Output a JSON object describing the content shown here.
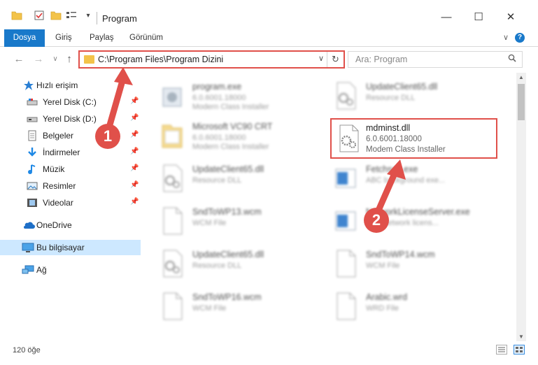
{
  "window": {
    "title": "Program",
    "controls": {
      "minimize": "—",
      "maximize": "☐",
      "close": "✕"
    }
  },
  "ribbon": {
    "tabs": [
      "Dosya",
      "Giriş",
      "Paylaş",
      "Görünüm"
    ],
    "help": "?",
    "chevron": "∨"
  },
  "address": {
    "path": "C:\\Program Files\\Program Dizini",
    "dropdown": "∨",
    "refresh": "↻"
  },
  "search": {
    "placeholder": "Ara: Program",
    "icon": "search-icon"
  },
  "nav": {
    "back": "←",
    "forward": "→",
    "recent": "∨",
    "up": "↑"
  },
  "sidebar": {
    "items": [
      {
        "label": "Hızlı erişim",
        "icon": "star-icon",
        "pinned": false
      },
      {
        "label": "Yerel Disk (C:)",
        "icon": "drive-icon",
        "pinned": true
      },
      {
        "label": "Yerel Disk (D:)",
        "icon": "drive-icon",
        "pinned": true
      },
      {
        "label": "Belgeler",
        "icon": "documents-icon",
        "pinned": true
      },
      {
        "label": "İndirmeler",
        "icon": "download-icon",
        "pinned": true
      },
      {
        "label": "Müzik",
        "icon": "music-icon",
        "pinned": true
      },
      {
        "label": "Resimler",
        "icon": "pictures-icon",
        "pinned": true
      },
      {
        "label": "Videolar",
        "icon": "video-icon",
        "pinned": true
      },
      {
        "label": "OneDrive",
        "icon": "cloud-icon",
        "pinned": false
      },
      {
        "label": "Bu bilgisayar",
        "icon": "computer-icon",
        "pinned": false
      },
      {
        "label": "Ağ",
        "icon": "network-icon",
        "pinned": false
      }
    ],
    "pin_glyph": "📌"
  },
  "files": [
    {
      "name": "program.exe",
      "line1": "6.0.6001.18000",
      "line2": "Modern Class Installer",
      "type": "exe"
    },
    {
      "name": "UpdateClient65.dll",
      "line1": "Resource DLL",
      "line2": "",
      "type": "dll"
    },
    {
      "name": "Microsoft VC90 CRT",
      "line1": "6.0.6001.18000",
      "line2": "Modern Class Installer",
      "type": "folder"
    },
    {
      "name": "UpdateClient65.dll",
      "line1": "Resource DLL",
      "line2": "",
      "type": "dll"
    },
    {
      "name": "Fetchsec.exe",
      "line1": "ABC background exe...",
      "line2": "",
      "type": "app"
    },
    {
      "name": "SndToWP13.wcm",
      "line1": "WCM File",
      "line2": "",
      "type": "doc"
    },
    {
      "name": "NetworkLicenseServer.exe",
      "line1": "BCF network licens...",
      "line2": "",
      "type": "app"
    },
    {
      "name": "UpdateClient65.dll",
      "line1": "Resource DLL",
      "line2": "",
      "type": "dll"
    },
    {
      "name": "SndToWP14.wcm",
      "line1": "WCM File",
      "line2": "",
      "type": "doc"
    },
    {
      "name": "SndToWP16.wcm",
      "line1": "WCM File",
      "line2": "",
      "type": "doc"
    },
    {
      "name": "Arabic.wrd",
      "line1": "WRD File",
      "line2": "",
      "type": "doc"
    }
  ],
  "highlighted_file": {
    "name": "mdminst.dll",
    "version": "6.0.6001.18000",
    "description": "Modem Class Installer"
  },
  "annotations": [
    "1",
    "2"
  ],
  "status": {
    "count": "120 öğe"
  },
  "colors": {
    "accent": "#1979ca",
    "annotation": "#e0504a",
    "selected": "#cde8ff",
    "folder": "#f3c34a"
  }
}
